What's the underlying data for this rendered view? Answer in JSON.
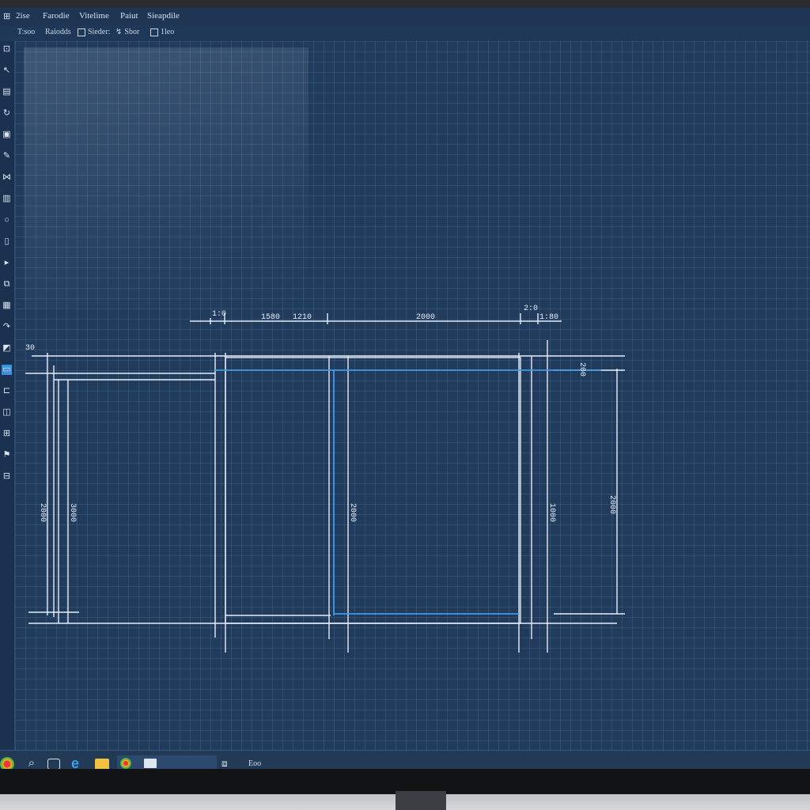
{
  "menu": {
    "items": [
      "2ise",
      "Farodie",
      "Vitelime",
      "Paiut",
      "Sieapdile"
    ]
  },
  "toolbar": {
    "items": [
      "T:soo",
      "Raiodds",
      "Sieder:",
      "Sbor",
      "1leo"
    ]
  },
  "tools": [
    "select-icon",
    "pointer-icon",
    "document-icon",
    "rotate-icon",
    "frame-icon",
    "pen-icon",
    "node-icon",
    "columns-icon",
    "circle-icon",
    "door-icon",
    "arrow-icon",
    "copy-icon",
    "grid-icon",
    "redo-icon",
    "fill-icon",
    "panel-icon",
    "crop-icon",
    "layers-icon",
    "window-icon",
    "flag-icon",
    "measure-icon"
  ],
  "drawing": {
    "dimensions": {
      "top_small_left": "1:0",
      "top_a": "1580",
      "top_b": "1210",
      "top_main": "2000",
      "top_small_right": "2:0",
      "top_right": "1:80",
      "left_small": "30",
      "left_a": "2000",
      "left_b": "3000",
      "mid": "2000",
      "right_a": "1000",
      "right_b": "2000",
      "right_small": "200"
    }
  },
  "taskbar": {
    "label": "Eoo"
  },
  "colors": {
    "accent_line": "#3f9be8",
    "drawing_line": "#e8eef5",
    "grid": "#4d6f96"
  }
}
